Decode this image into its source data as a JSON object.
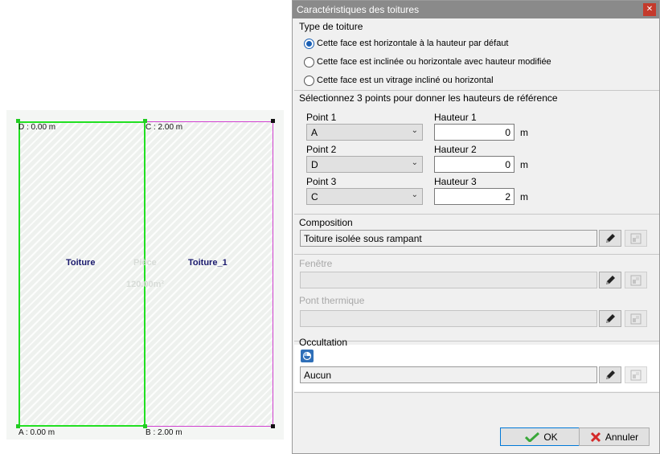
{
  "canvas": {
    "points": {
      "d": "D : 0.00 m",
      "c": "C : 2.00 m",
      "a": "A : 0.00 m",
      "b": "B : 2.00 m"
    },
    "faces": {
      "left": "Toiture",
      "right": "Toiture_1"
    },
    "room": {
      "name": "Pièce",
      "area": "120.00m²"
    },
    "colors": {
      "selected_face": "#22e022",
      "other_face": "#d040d0"
    }
  },
  "dialog": {
    "title": "Caractéristiques des toitures",
    "close_icon": "close-icon",
    "roof_type": {
      "label": "Type de toiture",
      "options": [
        "Cette face est horizontale à la hauteur par défaut",
        "Cette face est inclinée ou horizontale avec hauteur modifiée",
        "Cette face est un vitrage incliné ou horizontal"
      ],
      "selected_index": 0
    },
    "reference": {
      "label": "Sélectionnez 3 points pour donner les hauteurs de référence",
      "rows": [
        {
          "point_label": "Point 1",
          "point_value": "A",
          "height_label": "Hauteur 1",
          "height_value": "0",
          "unit": "m"
        },
        {
          "point_label": "Point 2",
          "point_value": "D",
          "height_label": "Hauteur 2",
          "height_value": "0",
          "unit": "m"
        },
        {
          "point_label": "Point 3",
          "point_value": "C",
          "height_label": "Hauteur 3",
          "height_value": "2",
          "unit": "m"
        }
      ]
    },
    "composition": {
      "label": "Composition",
      "value": "Toiture isolée sous rampant"
    },
    "window": {
      "label": "Fenêtre",
      "value": ""
    },
    "thermal_bridge": {
      "label": "Pont thermique",
      "value": ""
    },
    "occultation": {
      "label": "Occultation",
      "value": "Aucun",
      "icon": "shutter-icon"
    },
    "buttons": {
      "ok": "OK",
      "cancel": "Annuler"
    },
    "colors": {
      "titlebar": "#8a8a8a",
      "close": "#c43a2c",
      "radio_selected": "#1a5fb4"
    }
  }
}
